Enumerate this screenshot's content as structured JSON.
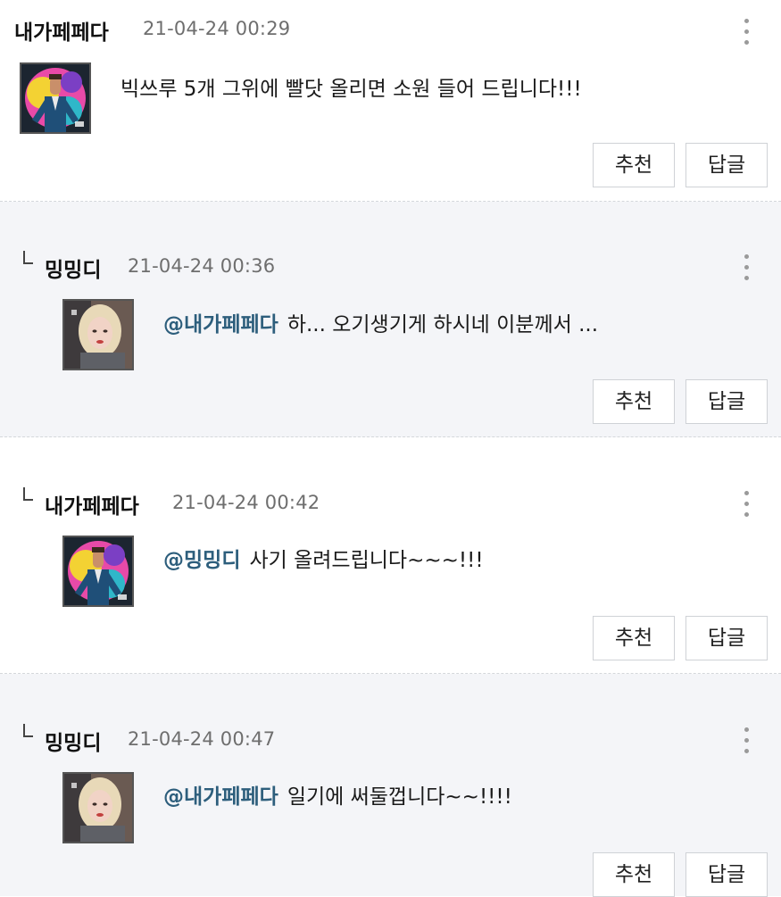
{
  "comments": [
    {
      "author": "내가페페다",
      "date": "21-04-24 00:29",
      "mention": "",
      "text": "빅쓰루 5개 그위에 빨닷 올리면 소원 들어 드립니다!!!",
      "avatar_icon": "man-in-suit-avatar",
      "recommend_label": "추천",
      "reply_label": "답글"
    },
    {
      "author": "밍밍디",
      "date": "21-04-24 00:36",
      "mention": "@내가페페다",
      "text": "하... 오기생기게 하시네 이분께서 ...",
      "avatar_icon": "blonde-woman-avatar",
      "recommend_label": "추천",
      "reply_label": "답글"
    },
    {
      "author": "내가페페다",
      "date": "21-04-24 00:42",
      "mention": "@밍밍디",
      "text": "사기 올려드립니다~~~!!!",
      "avatar_icon": "man-in-suit-avatar",
      "recommend_label": "추천",
      "reply_label": "답글"
    },
    {
      "author": "밍밍디",
      "date": "21-04-24 00:47",
      "mention": "@내가페페다",
      "text": "일기에 써둘껍니다~~!!!!",
      "avatar_icon": "blonde-woman-avatar",
      "recommend_label": "추천",
      "reply_label": "답글"
    }
  ],
  "colors": {
    "mention": "#2d5e7c",
    "reply_background": "#f4f5f8",
    "date": "#6e6e6e"
  }
}
